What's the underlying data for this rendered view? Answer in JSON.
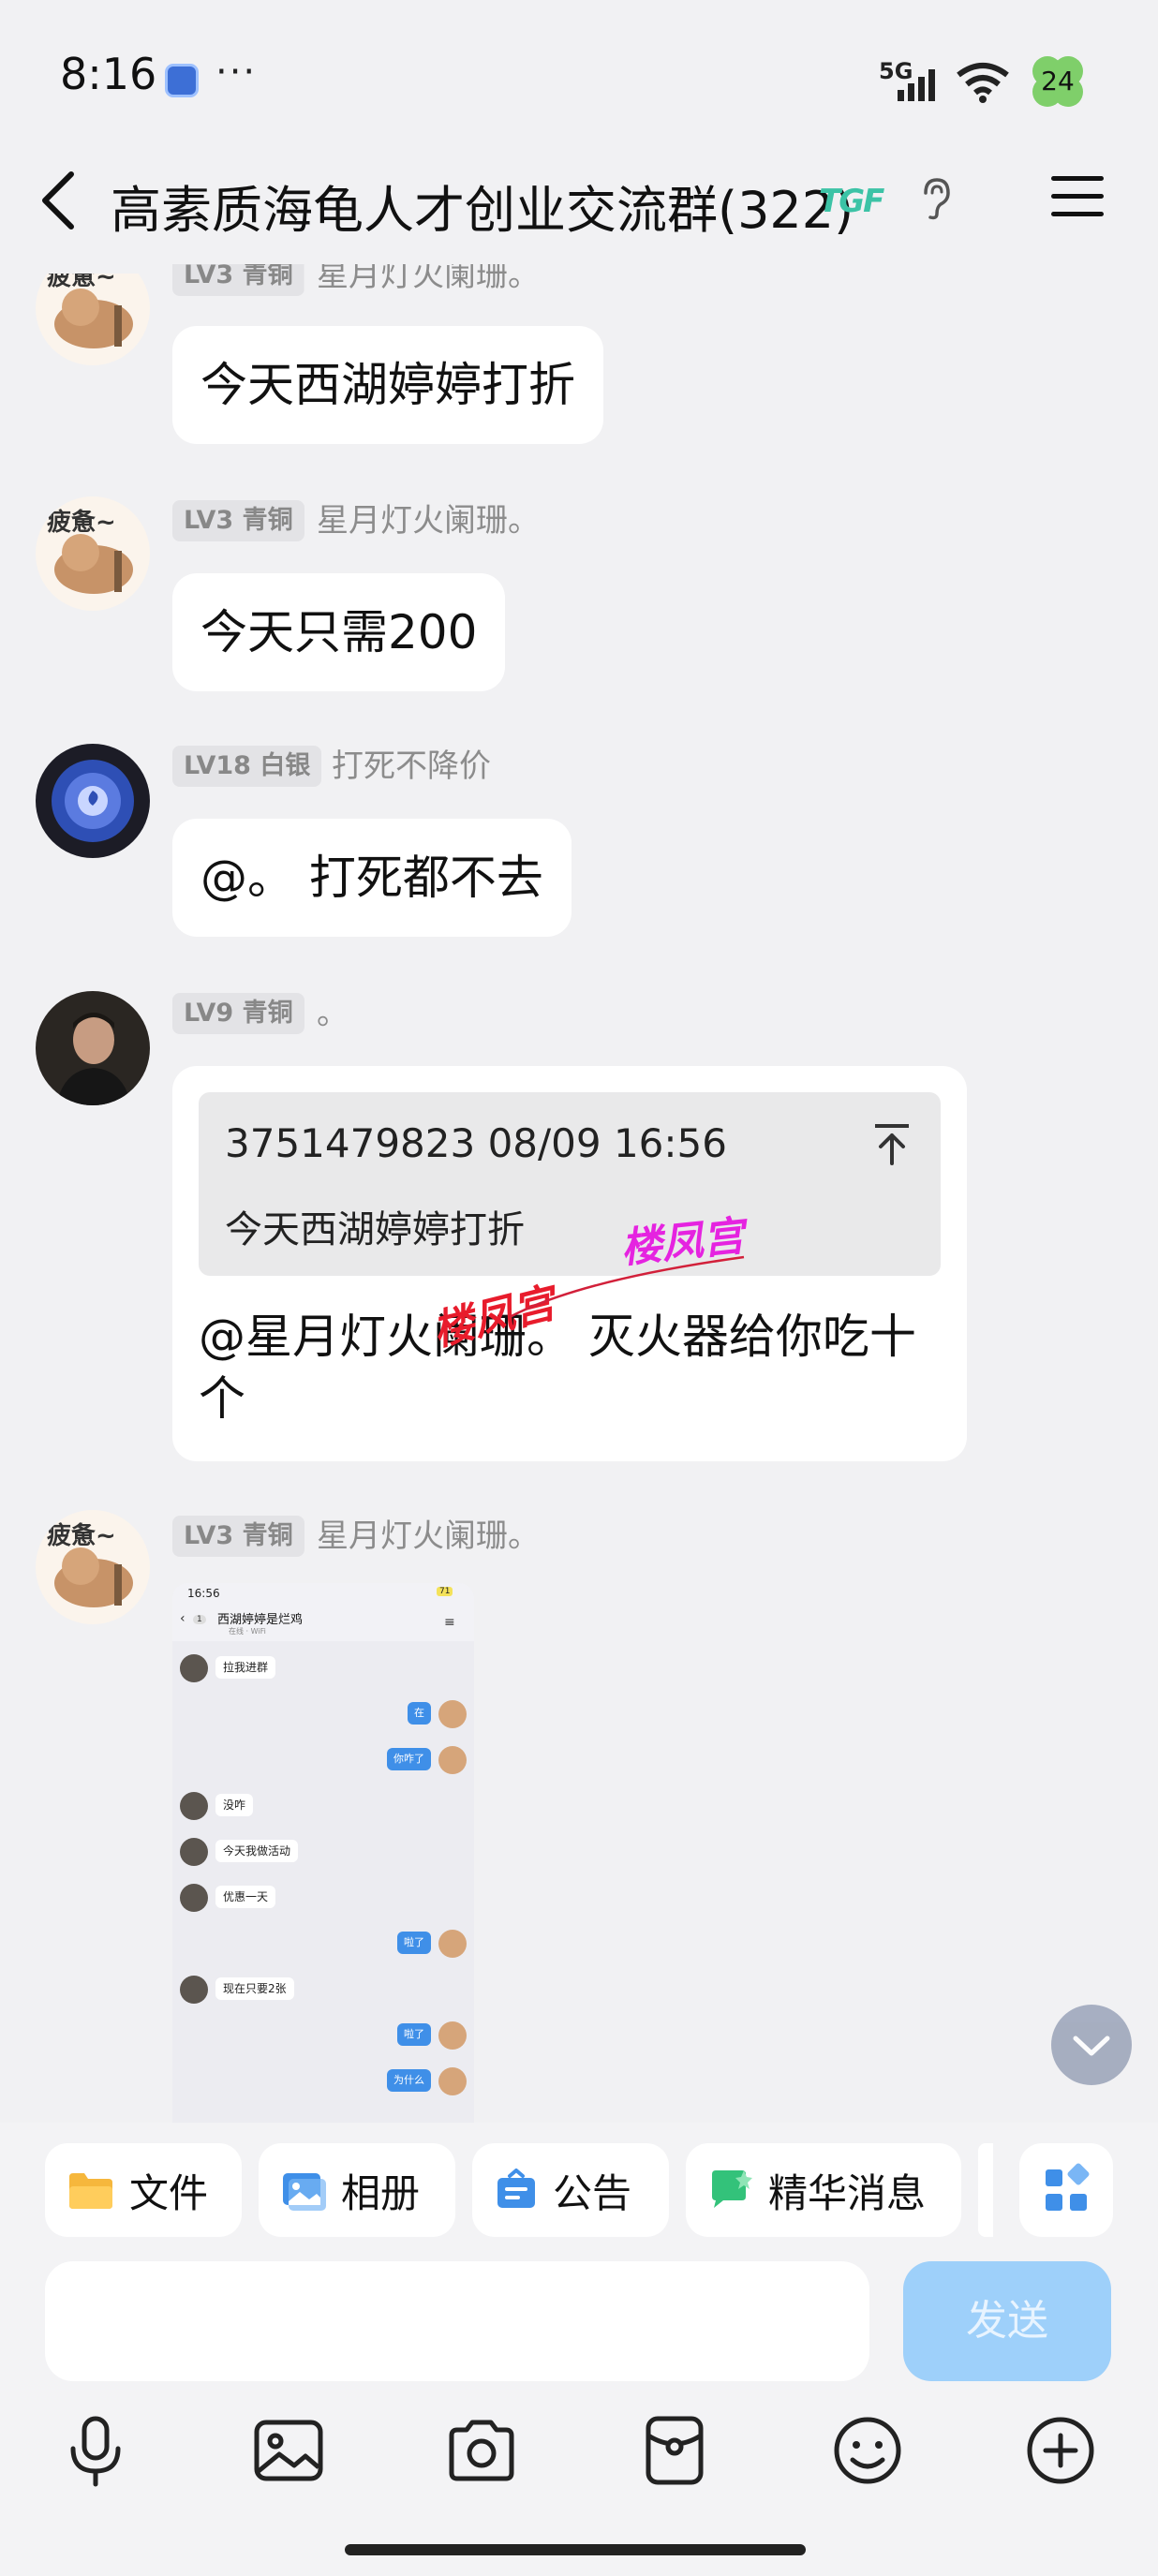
{
  "status_bar": {
    "time": "8:16",
    "more": "···",
    "network": "5G",
    "battery": "24"
  },
  "header": {
    "title": "高素质海龟人才创业交流群(322)",
    "badge": "TGF"
  },
  "messages": [
    {
      "level": "LV3 青铜",
      "nickname": "星月灯火阑珊。",
      "text": "今天西湖婷婷打折"
    },
    {
      "level": "LV3 青铜",
      "nickname": "星月灯火阑珊。",
      "text": "今天只需200"
    },
    {
      "level": "LV18 白银",
      "nickname": "打死不降价",
      "text": "@。 打死都不去"
    },
    {
      "level": "LV9 青铜",
      "nickname": "。",
      "quote": {
        "meta": "3751479823 08/09 16:56",
        "text": "今天西湖婷婷打折"
      },
      "text_line1": "@星月灯火阑珊。 灭火器给你吃十",
      "text_line2": "个"
    },
    {
      "level": "LV3 青铜",
      "nickname": "星月灯火阑珊。"
    }
  ],
  "watermarks": [
    "楼凤宫",
    "楼凤宫"
  ],
  "screenshot": {
    "time": "16:56",
    "battery": "71",
    "back_count": "1",
    "title": "西湖婷婷是烂鸡",
    "subtitle": "在线 · WiFi",
    "rows": [
      {
        "side": "left",
        "text": "拉我进群"
      },
      {
        "side": "right",
        "text": "在"
      },
      {
        "side": "right",
        "text": "你咋了"
      },
      {
        "side": "left",
        "text": "没咋"
      },
      {
        "side": "left",
        "text": "今天我做活动"
      },
      {
        "side": "left",
        "text": "优惠一天"
      },
      {
        "side": "right",
        "text": "啦了"
      },
      {
        "side": "left",
        "text": "现在只要2张"
      },
      {
        "side": "right",
        "text": "啦了"
      },
      {
        "side": "right",
        "text": "为什么"
      }
    ]
  },
  "quick_actions": [
    {
      "label": "文件",
      "icon": "folder-icon",
      "color": "#f6b73c"
    },
    {
      "label": "相册",
      "icon": "album-icon",
      "color": "#3f8fe8"
    },
    {
      "label": "公告",
      "icon": "announcement-icon",
      "color": "#3f8fe8"
    },
    {
      "label": "精华消息",
      "icon": "essence-icon",
      "color": "#33c27a"
    }
  ],
  "composer": {
    "send_label": "发送",
    "input_value": ""
  },
  "colors": {
    "accent": "#3f8fe8",
    "send_disabled": "#9ed0fa",
    "background": "#f1f1f3"
  }
}
